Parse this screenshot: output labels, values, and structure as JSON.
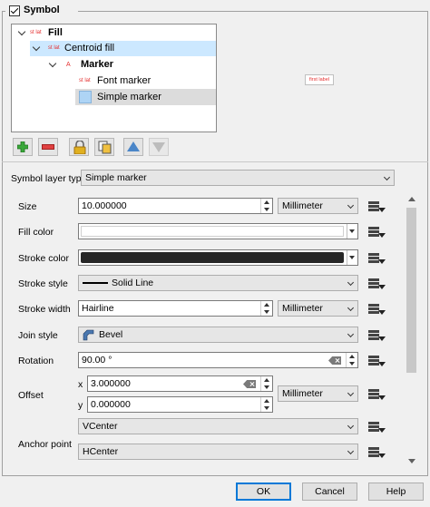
{
  "symbol_group": {
    "label": "Symbol",
    "checked": true
  },
  "tree": {
    "rows": [
      {
        "tag": "st lat",
        "label": "Fill"
      },
      {
        "tag": "st lat",
        "label": "Centroid fill"
      },
      {
        "tag": "A",
        "label": "Marker"
      },
      {
        "tag": "st lat",
        "label": "Font marker"
      },
      {
        "tag": "",
        "label": "Simple marker"
      }
    ]
  },
  "preview": {
    "text": "first label"
  },
  "toolbar": {
    "add_icon": "add-layer-icon",
    "remove_icon": "remove-layer-icon",
    "lock_icon": "lock-icon",
    "duplicate_icon": "duplicate-icon",
    "up_icon": "move-up-icon",
    "down_icon": "move-down-icon"
  },
  "layer_type": {
    "label": "Symbol layer type",
    "value": "Simple marker"
  },
  "properties": {
    "size": {
      "label": "Size",
      "value": "10.000000",
      "unit": "Millimeter"
    },
    "fill_color": {
      "label": "Fill color",
      "color": "#ffffff"
    },
    "stroke_color": {
      "label": "Stroke color",
      "color": "#262626"
    },
    "stroke_style": {
      "label": "Stroke style",
      "value": "Solid Line"
    },
    "stroke_width": {
      "label": "Stroke width",
      "value": "Hairline",
      "unit": "Millimeter"
    },
    "join_style": {
      "label": "Join style",
      "value": "Bevel"
    },
    "rotation": {
      "label": "Rotation",
      "value": "90.00 °"
    },
    "offset": {
      "label": "Offset",
      "x_label": "x",
      "x": "3.000000",
      "y_label": "y",
      "y": "0.000000",
      "unit": "Millimeter"
    },
    "anchor": {
      "label": "Anchor point",
      "vertical": "VCenter",
      "horizontal": "HCenter"
    }
  },
  "footer": {
    "ok": "OK",
    "cancel": "Cancel",
    "help": "Help"
  },
  "colors": {
    "accent": "#0078d7",
    "selection": "#cce8ff",
    "tag_red": "#e53030"
  }
}
